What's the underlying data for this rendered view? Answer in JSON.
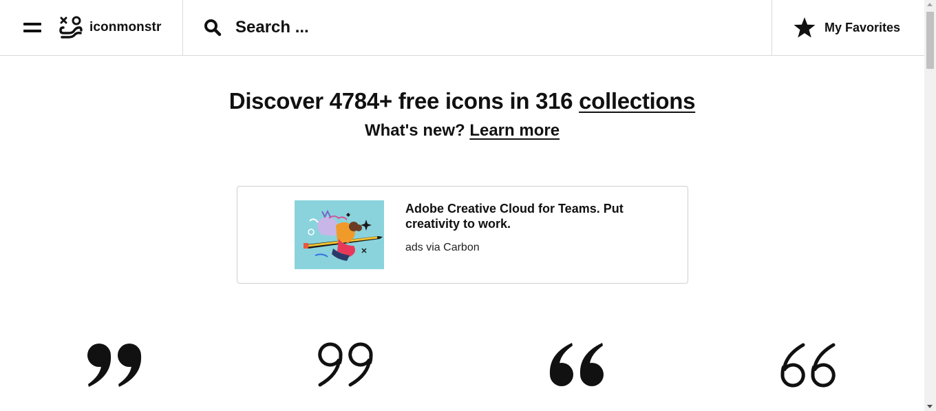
{
  "header": {
    "brand_name": "iconmonstr",
    "search_placeholder": "Search ...",
    "favorites_label": "My Favorites"
  },
  "hero": {
    "headline_prefix": "Discover 4784+ free icons in 316 ",
    "headline_link": "collections",
    "sub_prefix": "What's new? ",
    "sub_link": "Learn more"
  },
  "ad": {
    "title": "Adobe Creative Cloud for Teams. Put creativity to work.",
    "via": "ads via Carbon"
  },
  "icons": [
    {
      "name": "quote-close-filled-icon"
    },
    {
      "name": "quote-close-outline-icon"
    },
    {
      "name": "quote-open-filled-icon"
    },
    {
      "name": "quote-open-outline-icon"
    }
  ],
  "colors": {
    "text": "#111111",
    "border": "#d9d9d9",
    "ad_image_bg": "#8ad3dc"
  }
}
